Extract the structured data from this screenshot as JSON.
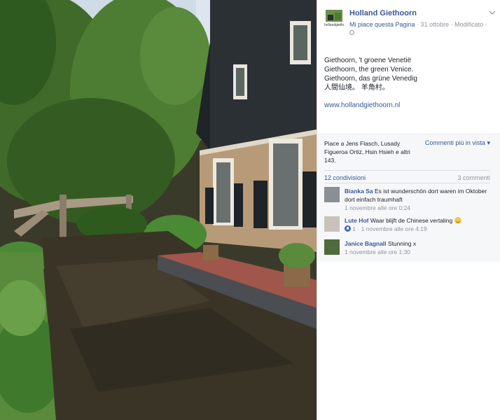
{
  "post": {
    "page_name": "Holland Giethoorn",
    "avatar_text": "hollandgiethoorn",
    "like_page": "Mi piace questa Pagina",
    "meta_rest": " · 31 ottobre · Modificato ·",
    "text_lines": [
      "Giethoorn, 't groene Venetië",
      "Giethoorn, the green Venice.",
      "Giethoorn, das grüne Venedig",
      "人間仙境。 羊角村。"
    ],
    "link": "www.hollandgiethoorn.nl"
  },
  "ufi": {
    "likes_text": "Piace a Jens Flasch, Lusady Figueroa Ortiz, Hsin Hsieh e altri 143.",
    "sort_label": "Commenti più in vista",
    "shares": "12 condivisioni",
    "comments_count": "3 commenti"
  },
  "comments": [
    {
      "name": "Bianka Sa",
      "text": "Es ist wunderschön dort waren im Oktober dort einfach traumhaft",
      "likes": "",
      "time": "1 novembre alle ore 0:24",
      "avatar_color": "#8a8f96"
    },
    {
      "name": "Lute Hof",
      "text": "Waar blijft de Chinese vertaling",
      "likes": "1",
      "time": "1 novembre alle ore 4:19",
      "avatar_color": "#c9c2b8"
    },
    {
      "name": "Janice Bagnall",
      "text": "Stunning x",
      "likes": "",
      "time": "1 novembre alle ore 1:30",
      "avatar_color": "#4f6a3c"
    }
  ]
}
